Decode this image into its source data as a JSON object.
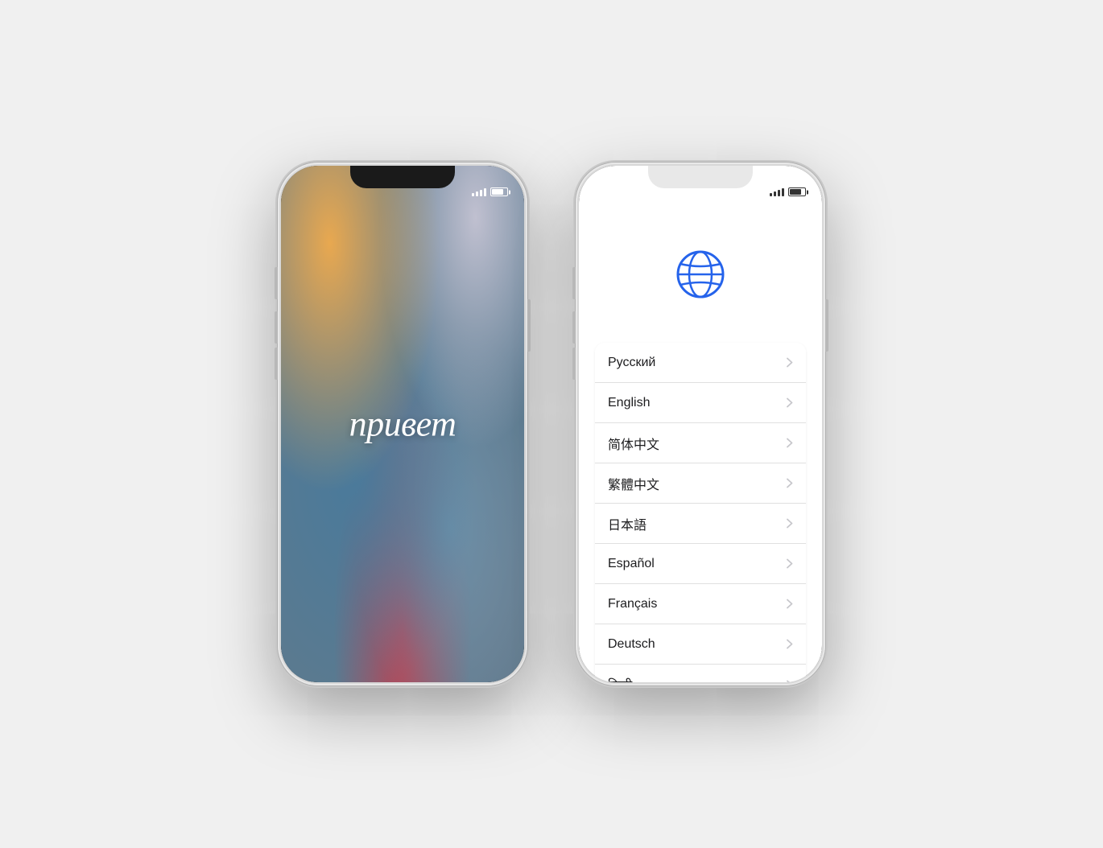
{
  "left_phone": {
    "greeting": "привет"
  },
  "right_phone": {
    "languages": [
      {
        "id": "russian",
        "name": "Русский"
      },
      {
        "id": "english",
        "name": "English"
      },
      {
        "id": "simplified-chinese",
        "name": "简体中文"
      },
      {
        "id": "traditional-chinese",
        "name": "繁體中文"
      },
      {
        "id": "japanese",
        "name": "日本語"
      },
      {
        "id": "spanish",
        "name": "Español"
      },
      {
        "id": "french",
        "name": "Français"
      },
      {
        "id": "german",
        "name": "Deutsch"
      },
      {
        "id": "hindi",
        "name": "हिन्दी"
      }
    ]
  },
  "colors": {
    "globe_blue": "#2563eb",
    "chevron_gray": "#c7c7cc",
    "text_dark": "#1c1c1e",
    "separator": "#e0e0e0"
  }
}
